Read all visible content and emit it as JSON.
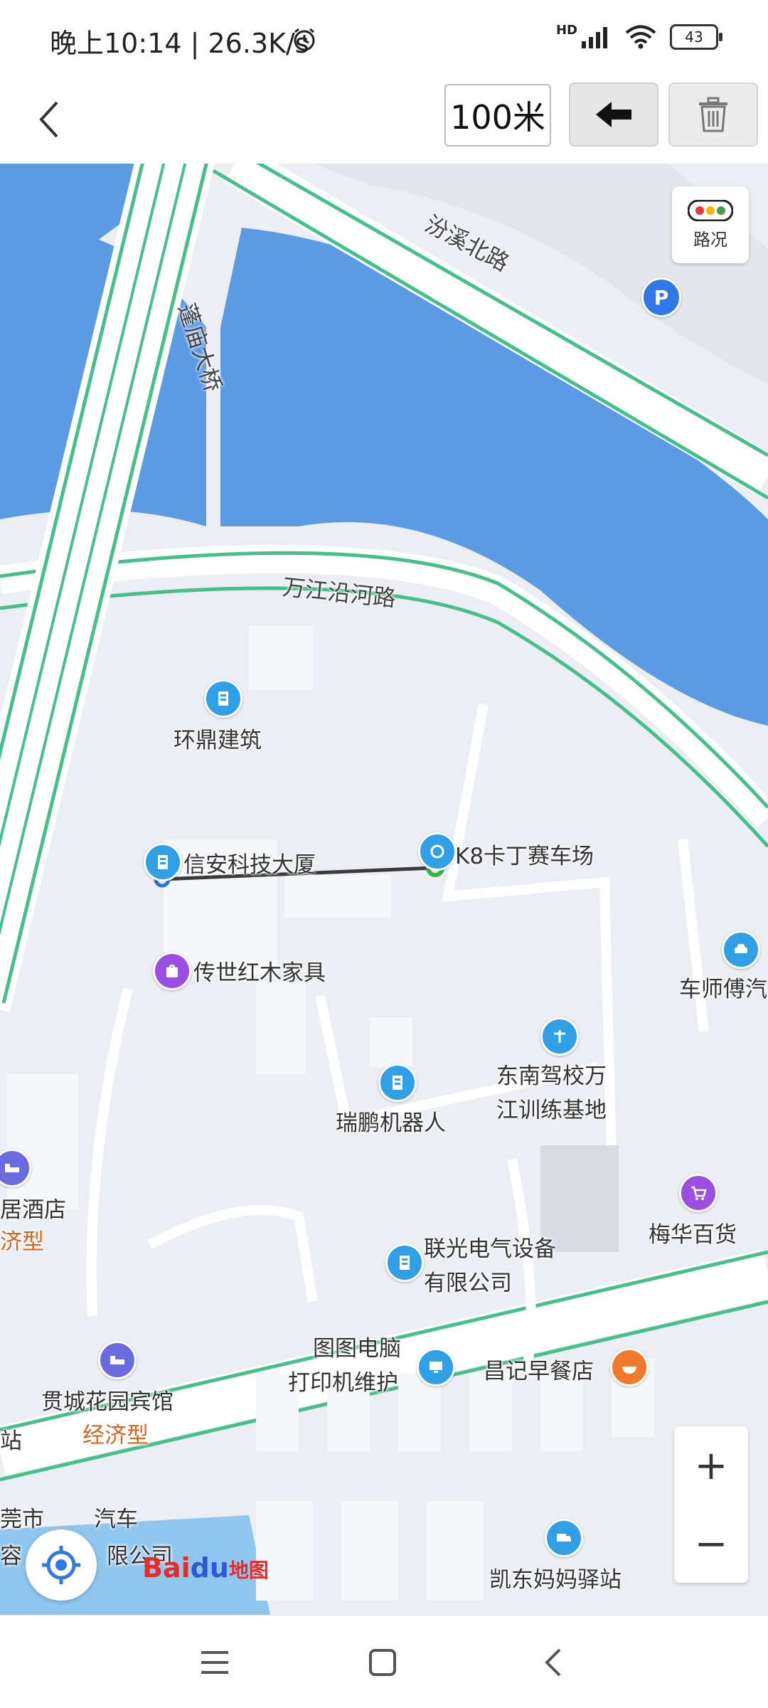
{
  "status_bar": {
    "time_speed": "晚上10:14 | 26.3K/s",
    "network": "HD",
    "battery": "43"
  },
  "toolbar": {
    "back_icon": "chevron-left-icon",
    "distance": "100米",
    "undo_icon": "arrow-left-icon",
    "delete_icon": "trash-icon"
  },
  "map": {
    "traffic_label": "路况",
    "roads": {
      "bridge": "蓬庙大桥",
      "north_road": "汾溪北路",
      "river_road": "万江沿河路"
    },
    "pois": {
      "huanding": "环鼎建筑",
      "xinan": "信安科技大厦",
      "k8": "K8卡丁赛车场",
      "chuanshi": "传世红木家具",
      "cheshifu": "车师傅汽",
      "dongnan_1": "东南驾校万",
      "dongnan_2": "江训练基地",
      "ruipeng": "瑞鹏机器人",
      "hotel1_name": "居酒店",
      "hotel1_type": "济型",
      "meihua": "梅华百货",
      "lianguang_1": "联光电气设备",
      "lianguang_2": "有限公司",
      "tutu_1": "图图电脑",
      "tutu_2": "打印机维护",
      "changji": "昌记早餐店",
      "guancheng": "贯城花园宾馆",
      "guancheng_type": "经济型",
      "zhan": "站",
      "auto_1": "莞市",
      "auto_2": "汽车",
      "auto_3": "容",
      "auto_4": "限公司",
      "kaidong": "凯东妈妈驿站"
    },
    "zoom_in": "+",
    "zoom_out": "−",
    "logo_text": "Bai",
    "logo_paw": "du",
    "logo_suffix": "地图"
  },
  "nav": {
    "menu_icon": "menu-icon",
    "home_icon": "home-square-icon",
    "back_icon": "back-triangle-icon"
  }
}
